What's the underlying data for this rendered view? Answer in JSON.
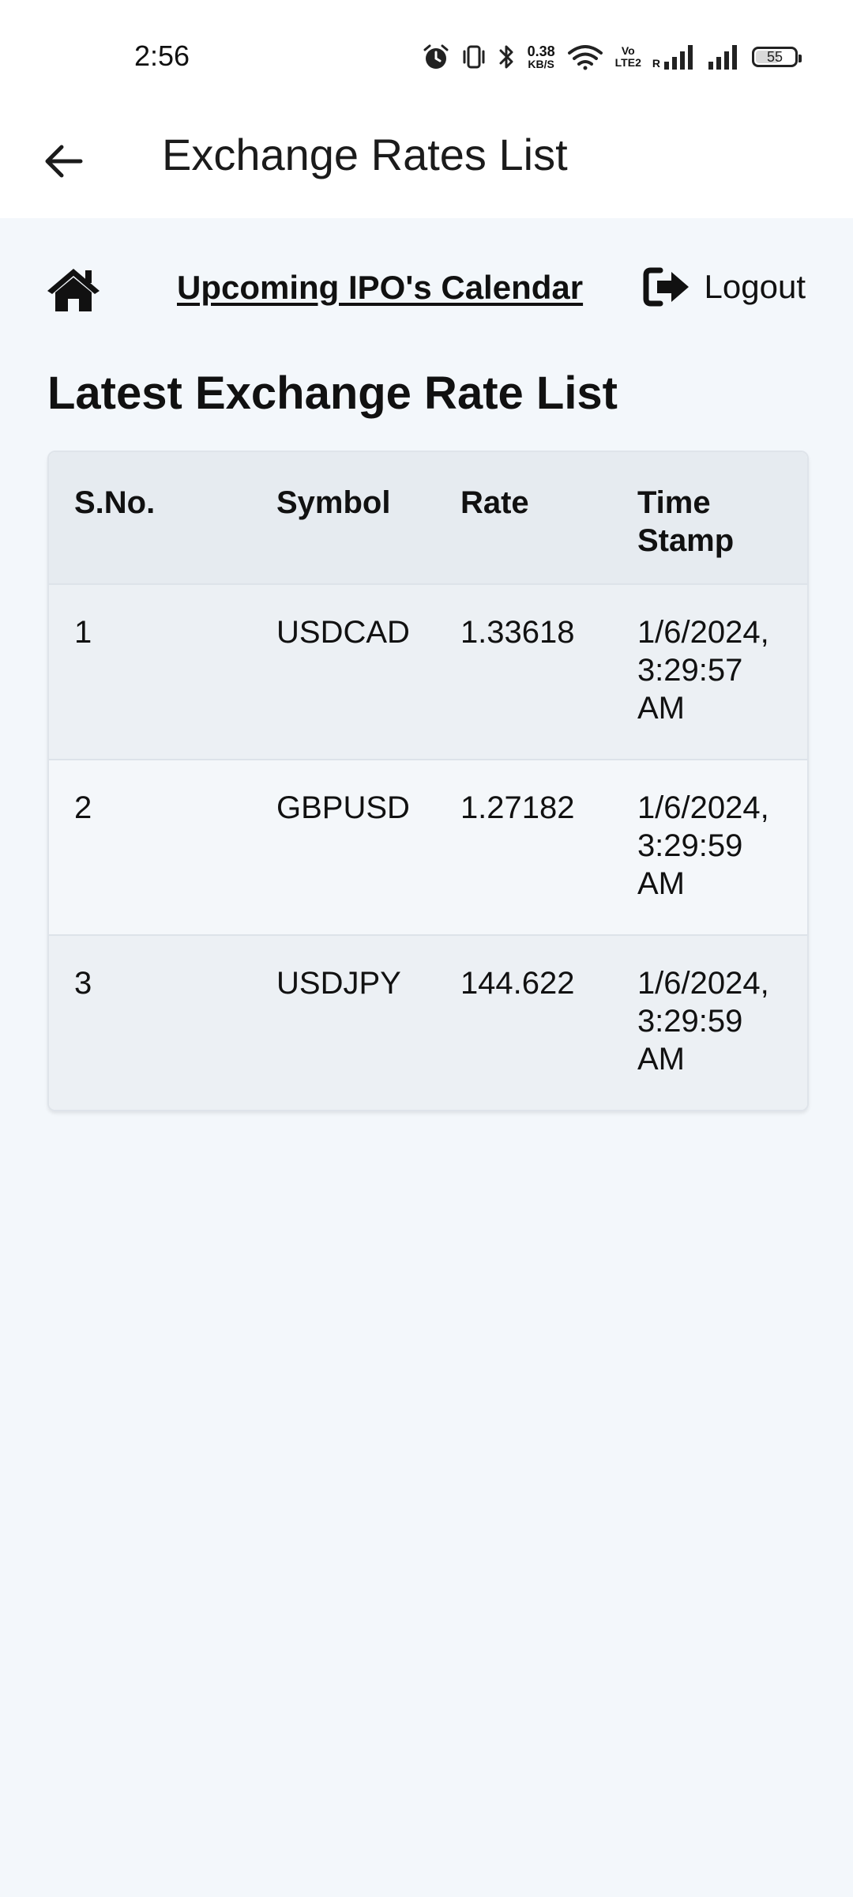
{
  "status_bar": {
    "time": "2:56",
    "net_speed_value": "0.38",
    "net_speed_unit": "KB/S",
    "volte_top": "Vo",
    "volte_bottom": "LTE2",
    "roaming": "R",
    "battery": "55",
    "icons": [
      "alarm-icon",
      "vibrate-icon",
      "bluetooth-icon",
      "wifi-icon",
      "signal-icon",
      "signal-icon",
      "battery-icon"
    ]
  },
  "app_bar": {
    "title": "Exchange Rates List",
    "back_icon": "arrow-left-icon"
  },
  "nav": {
    "home_icon": "home-icon",
    "ipo_link": "Upcoming IPO's Calendar",
    "logout_icon": "sign-out-icon",
    "logout_label": "Logout"
  },
  "section_title": "Latest Exchange Rate List",
  "table": {
    "headers": [
      "S.No.",
      "Symbol",
      "Rate",
      "Time Stamp"
    ],
    "rows": [
      {
        "sno": "1",
        "symbol": "USDCAD",
        "rate": "1.33618",
        "timestamp": "1/6/2024, 3:29:57 AM"
      },
      {
        "sno": "2",
        "symbol": "GBPUSD",
        "rate": "1.27182",
        "timestamp": "1/6/2024, 3:29:59 AM"
      },
      {
        "sno": "3",
        "symbol": "USDJPY",
        "rate": "144.622",
        "timestamp": "1/6/2024, 3:29:59 AM"
      }
    ]
  },
  "colors": {
    "page_background": "#f3f7fb",
    "header_row": "#e6ebf0",
    "row_odd": "#ecf0f4",
    "row_even": "#f4f7fa",
    "text": "#111111"
  }
}
